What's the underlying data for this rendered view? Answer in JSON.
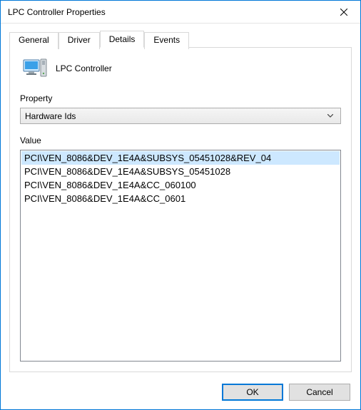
{
  "window": {
    "title": "LPC Controller Properties"
  },
  "tabs": {
    "general": "General",
    "driver": "Driver",
    "details": "Details",
    "events": "Events"
  },
  "device": {
    "name": "LPC Controller"
  },
  "property": {
    "label": "Property",
    "selected": "Hardware Ids"
  },
  "value": {
    "label": "Value",
    "items": [
      "PCI\\VEN_8086&DEV_1E4A&SUBSYS_05451028&REV_04",
      "PCI\\VEN_8086&DEV_1E4A&SUBSYS_05451028",
      "PCI\\VEN_8086&DEV_1E4A&CC_060100",
      "PCI\\VEN_8086&DEV_1E4A&CC_0601"
    ]
  },
  "buttons": {
    "ok": "OK",
    "cancel": "Cancel"
  }
}
